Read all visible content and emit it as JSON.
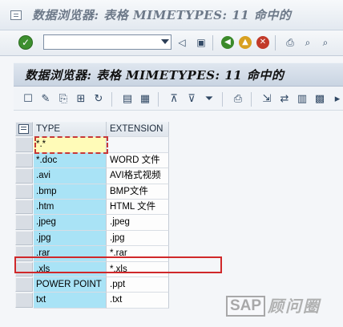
{
  "window": {
    "title": "数据浏览器: 表格 MIMETYPES:    11 命中的"
  },
  "system_toolbar": {
    "command_field_value": ""
  },
  "app": {
    "title": "数据浏览器: 表格 MIMETYPES:    11 命中的"
  },
  "grid": {
    "columns": [
      "TYPE",
      "EXTENSION"
    ],
    "rows": [
      {
        "type": "*.*",
        "extension": ""
      },
      {
        "type": "*.doc",
        "extension": "WORD 文件"
      },
      {
        "type": ".avi",
        "extension": "AVI格式视频"
      },
      {
        "type": ".bmp",
        "extension": "BMP文件"
      },
      {
        "type": ".htm",
        "extension": "HTML 文件"
      },
      {
        "type": ".jpeg",
        "extension": ".jpeg"
      },
      {
        "type": ".jpg",
        "extension": ".jpg"
      },
      {
        "type": ".rar",
        "extension": "*.rar"
      },
      {
        "type": ".xls",
        "extension": "*.xls"
      },
      {
        "type": "POWER POINT",
        "extension": ".ppt"
      },
      {
        "type": "txt",
        "extension": ".txt"
      }
    ]
  },
  "watermark": {
    "latin": "SAP",
    "cjk": "顾问圈"
  },
  "icons": {
    "menu": "window-menu-icon",
    "ok": "enter-check-icon",
    "save": "save-icon",
    "back": "back-icon",
    "exit": "exit-icon",
    "cancel": "cancel-icon",
    "print": "print-icon",
    "find": "find-icon",
    "find_next": "find-next-icon"
  },
  "colors": {
    "type_column_bg": "#a9e3f6",
    "input_cell_bg": "#fffbb8",
    "highlight_border": "#d0282a"
  }
}
